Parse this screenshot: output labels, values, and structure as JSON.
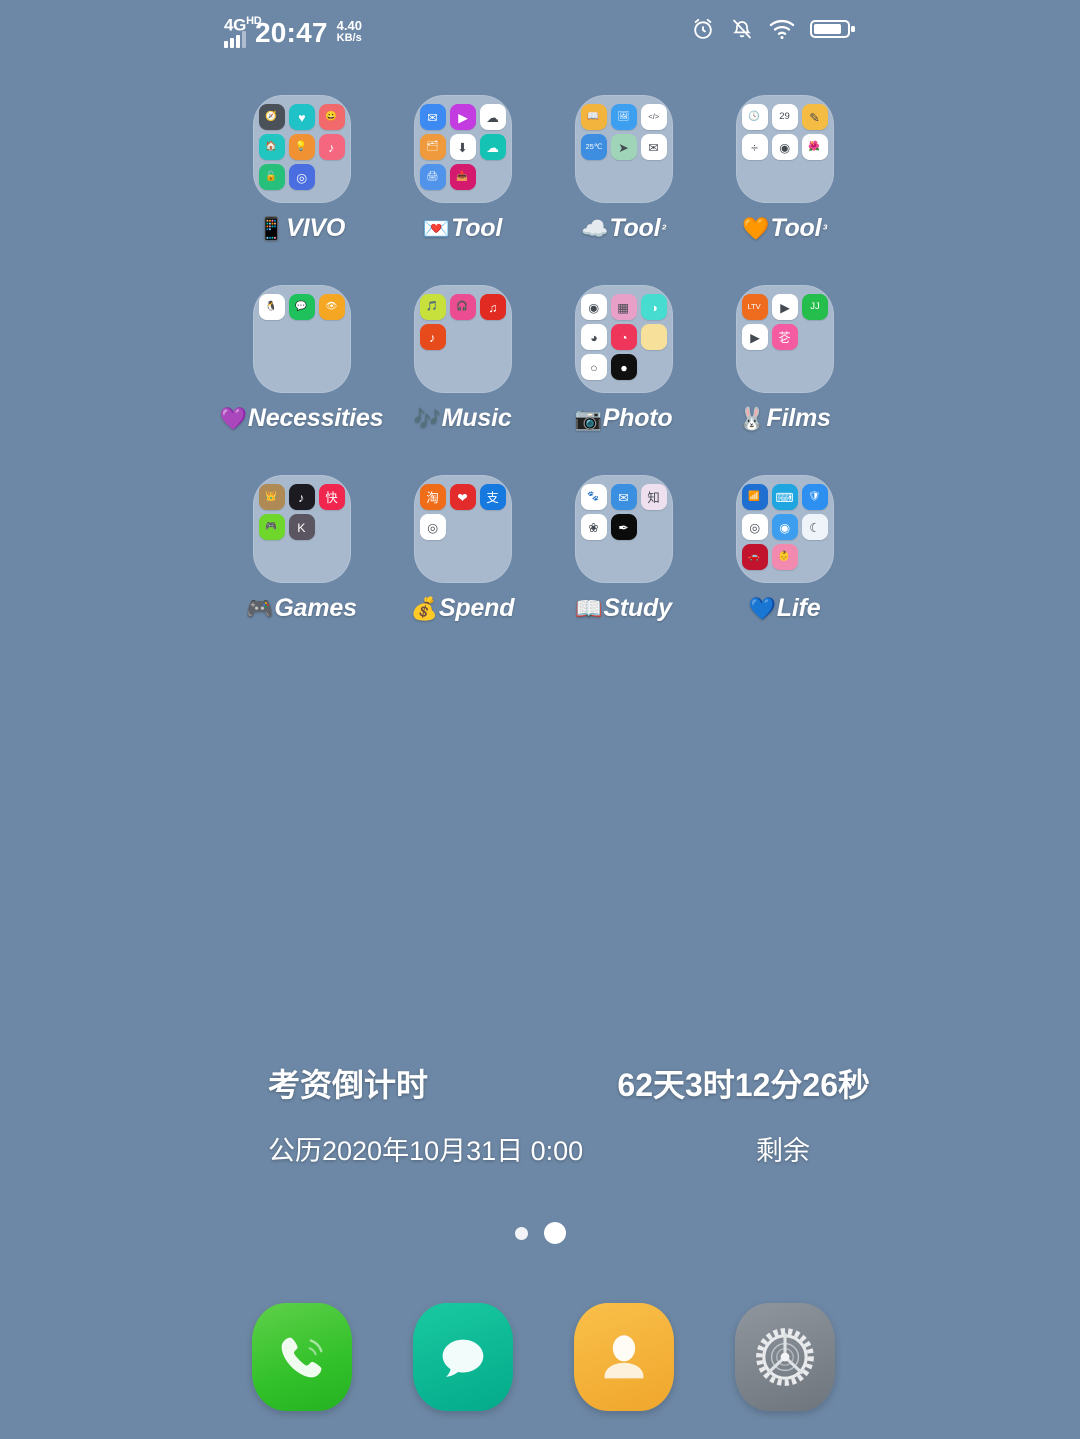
{
  "status_bar": {
    "network_type": "4G",
    "network_suffix": "HD",
    "time": "20:47",
    "net_speed_value": "4.40",
    "net_speed_unit": "KB/s",
    "icons": [
      "alarm-icon",
      "mute-icon",
      "wifi-icon",
      "battery-icon"
    ]
  },
  "home_screen": {
    "background_color": "#6d88a6",
    "rows": [
      [
        {
          "emoji": "📱",
          "name": "VIVO",
          "sup": "",
          "apps": [
            {
              "name": "compass-app",
              "glyph": "🧭",
              "color": "#4b5159"
            },
            {
              "name": "health-app",
              "glyph": "♥",
              "color": "#1fc2c6"
            },
            {
              "name": "emoji-app",
              "glyph": "😀",
              "color": "#f2696b"
            },
            {
              "name": "smart-home-app",
              "glyph": "🏠",
              "color": "#21c6c0"
            },
            {
              "name": "tips-app",
              "glyph": "💡",
              "color": "#f09234"
            },
            {
              "name": "ringtone-app",
              "glyph": "♪",
              "color": "#f4677f"
            },
            {
              "name": "privacy-lock-app",
              "glyph": "🔓",
              "color": "#26c07a"
            },
            {
              "name": "app-clone-app",
              "glyph": "◎",
              "color": "#4a6de0"
            }
          ]
        },
        {
          "emoji": "💌",
          "name": "Tool",
          "sup": "",
          "apps": [
            {
              "name": "mail-app",
              "glyph": "✉",
              "color": "#3d8bf2"
            },
            {
              "name": "video-player-app",
              "glyph": "▶",
              "color": "#c23ce0"
            },
            {
              "name": "cloud-app",
              "glyph": "☁",
              "color": "#ffffff"
            },
            {
              "name": "files-app",
              "glyph": "🗂",
              "color": "#ef9a3c"
            },
            {
              "name": "downloader-app",
              "glyph": "⬇",
              "color": "#ffffff"
            },
            {
              "name": "weather-cloud-app",
              "glyph": "☁",
              "color": "#15c3b4"
            },
            {
              "name": "printer-app",
              "glyph": "🖨",
              "color": "#4f93ea"
            },
            {
              "name": "inbox-app",
              "glyph": "📥",
              "color": "#d41a6e"
            }
          ]
        },
        {
          "emoji": "☁️",
          "name": "Tool",
          "sup": "²",
          "apps": [
            {
              "name": "reader-app",
              "glyph": "📖",
              "color": "#f2b43c"
            },
            {
              "name": "gallery-app",
              "glyph": "🖼",
              "color": "#3d9ff0"
            },
            {
              "name": "developer-app",
              "glyph": "</>",
              "color": "#ffffff"
            },
            {
              "name": "weather-app",
              "glyph": "25℃",
              "color": "#3d8de0"
            },
            {
              "name": "telegram-app",
              "glyph": "➤",
              "color": "#9fd4b8"
            },
            {
              "name": "envelope-app",
              "glyph": "✉",
              "color": "#ffffff"
            }
          ]
        },
        {
          "emoji": "🧡",
          "name": "Tool",
          "sup": "³",
          "apps": [
            {
              "name": "clock-app",
              "glyph": "🕓",
              "color": "#ffffff"
            },
            {
              "name": "calendar-app",
              "glyph": "29",
              "color": "#ffffff"
            },
            {
              "name": "notes-app",
              "glyph": "✎",
              "color": "#f5bc44"
            },
            {
              "name": "calculator-app",
              "glyph": "÷",
              "color": "#ffffff"
            },
            {
              "name": "recorder-app",
              "glyph": "◉",
              "color": "#ffffff"
            },
            {
              "name": "themes-app",
              "glyph": "🌺",
              "color": "#ffffff"
            }
          ]
        }
      ],
      [
        {
          "emoji": "💜",
          "name": "Necessities",
          "sup": "",
          "apps": [
            {
              "name": "qq-app",
              "glyph": "🐧",
              "color": "#ffffff"
            },
            {
              "name": "wechat-app",
              "glyph": "💬",
              "color": "#1ec15c"
            },
            {
              "name": "weibo-app",
              "glyph": "👁",
              "color": "#f5a623"
            }
          ]
        },
        {
          "emoji": "🎶",
          "name": "Music",
          "sup": "",
          "apps": [
            {
              "name": "kugou-app",
              "glyph": "🎵",
              "color": "#c8e03c"
            },
            {
              "name": "kuwo-app",
              "glyph": "🎧",
              "color": "#ec4d92"
            },
            {
              "name": "netease-music-app",
              "glyph": "♫",
              "color": "#e02a22"
            },
            {
              "name": "qq-music-app",
              "glyph": "♪",
              "color": "#e74b1c"
            }
          ]
        },
        {
          "emoji": "📷",
          "name": "Photo",
          "sup": "",
          "apps": [
            {
              "name": "camera-app",
              "glyph": "◉",
              "color": "#ffffff"
            },
            {
              "name": "gallery-grid-app",
              "glyph": "▦",
              "color": "#e9a0c8"
            },
            {
              "name": "beauty-cam-app",
              "glyph": "◑",
              "color": "#46dcd0"
            },
            {
              "name": "photo-editor-app",
              "glyph": "◕",
              "color": "#ffffff"
            },
            {
              "name": "faceu-app",
              "glyph": "◔",
              "color": "#f0355b"
            },
            {
              "name": "sticker-app",
              "glyph": "",
              "color": "#f7e09a"
            },
            {
              "name": "retouch-app",
              "glyph": "○",
              "color": "#ffffff"
            },
            {
              "name": "filter-app",
              "glyph": "●",
              "color": "#101010"
            }
          ]
        },
        {
          "emoji": "🐰",
          "name": "Films",
          "sup": "",
          "apps": [
            {
              "name": "letv-app",
              "glyph": "LTV",
              "color": "#ef6b1d"
            },
            {
              "name": "iqiyi-app",
              "glyph": "▶",
              "color": "#ffffff"
            },
            {
              "name": "pptv-app",
              "glyph": "JJ",
              "color": "#25bd4c"
            },
            {
              "name": "tencent-video-app",
              "glyph": "▶",
              "color": "#ffffff"
            },
            {
              "name": "mango-tv-app",
              "glyph": "芲",
              "color": "#f45ba0"
            }
          ]
        }
      ],
      [
        {
          "emoji": "🎮",
          "name": "Games",
          "sup": "",
          "apps": [
            {
              "name": "honor-of-kings-app",
              "glyph": "👑",
              "color": "#b08a55"
            },
            {
              "name": "tiktok-app",
              "glyph": "♪",
              "color": "#1d1b22"
            },
            {
              "name": "kuaishou-app",
              "glyph": "快",
              "color": "#f0264e"
            },
            {
              "name": "mini-game-app",
              "glyph": "🎮",
              "color": "#6fd62b"
            },
            {
              "name": "kuaikan-app",
              "glyph": "K",
              "color": "#5a5560"
            }
          ]
        },
        {
          "emoji": "💰",
          "name": "Spend",
          "sup": "",
          "apps": [
            {
              "name": "taobao-app",
              "glyph": "淘",
              "color": "#ef6c18"
            },
            {
              "name": "pinduoduo-app",
              "glyph": "❤",
              "color": "#e32b2b"
            },
            {
              "name": "alipay-app",
              "glyph": "支",
              "color": "#1579e0"
            },
            {
              "name": "xianyu-app",
              "glyph": "◎",
              "color": "#ffffff"
            }
          ]
        },
        {
          "emoji": "📖",
          "name": "Study",
          "sup": "",
          "apps": [
            {
              "name": "baidu-app",
              "glyph": "🐾",
              "color": "#ffffff"
            },
            {
              "name": "youdao-app",
              "glyph": "✉",
              "color": "#3a8fe0"
            },
            {
              "name": "zhihu-app",
              "glyph": "知",
              "color": "#efe0ef"
            },
            {
              "name": "xuexitong-app",
              "glyph": "❀",
              "color": "#ffffff"
            },
            {
              "name": "notepad-app",
              "glyph": "✒",
              "color": "#0b0b0b"
            }
          ]
        },
        {
          "emoji": "💙",
          "name": "Life",
          "sup": "",
          "apps": [
            {
              "name": "wifi-master-app",
              "glyph": "📶",
              "color": "#1f6fd0"
            },
            {
              "name": "keyboard-app",
              "glyph": "⌨",
              "color": "#1fa5e0"
            },
            {
              "name": "security-app",
              "glyph": "🛡",
              "color": "#2d8ff0"
            },
            {
              "name": "browser-app",
              "glyph": "◎",
              "color": "#ffffff"
            },
            {
              "name": "qq-browser-app",
              "glyph": "◉",
              "color": "#3d9ef0"
            },
            {
              "name": "moon-app",
              "glyph": "☾",
              "color": "#eef4fa"
            },
            {
              "name": "meituan-app",
              "glyph": "🚗",
              "color": "#c1122e"
            },
            {
              "name": "baby-app",
              "glyph": "👶",
              "color": "#f28ab0"
            }
          ]
        }
      ]
    ]
  },
  "countdown_widget": {
    "title": "考资倒计时",
    "value": "62天3时12分26秒",
    "date": "公历2020年10月31日 0:00",
    "remaining_label": "剩余"
  },
  "page_indicator": {
    "total": 2,
    "active_index": 1
  },
  "dock": [
    {
      "name": "phone-app",
      "label": "Phone",
      "color": "#32c12a",
      "icon": "phone-icon"
    },
    {
      "name": "messages-app",
      "label": "Messages",
      "color": "#03aa8b",
      "icon": "message-bubble-icon"
    },
    {
      "name": "contacts-app",
      "label": "Contacts",
      "color": "#f0a62c",
      "icon": "person-icon"
    },
    {
      "name": "settings-app",
      "label": "Settings",
      "color": "#6e757d",
      "icon": "gear-icon"
    }
  ]
}
